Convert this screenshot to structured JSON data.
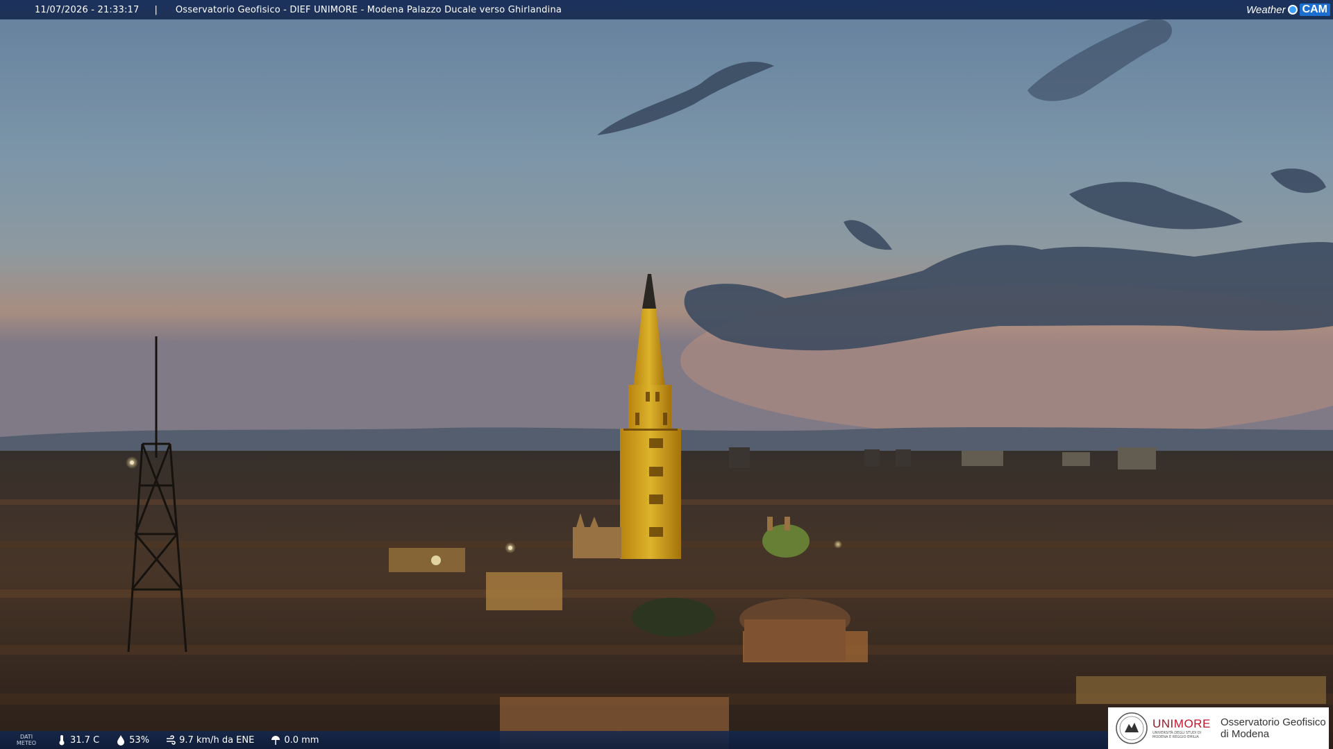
{
  "header": {
    "timestamp": "11/07/2026 - 21:33:17",
    "separator": "|",
    "title": "Osservatorio Geofisico - DIEF UNIMORE - Modena Palazzo Ducale verso Ghirlandina",
    "brand_weather": "Weather",
    "brand_cam": "CAM"
  },
  "weather": {
    "label_line1": "DATI",
    "label_line2": "METEO",
    "temperature": "31.7 C",
    "humidity": "53%",
    "wind": "9.7 km/h da ENE",
    "rain": "0.0 mm",
    "icons": [
      "thermometer-icon",
      "humidity-drop-icon",
      "wind-icon",
      "rain-gauge-icon"
    ]
  },
  "logo": {
    "uni_prefix": "UNI",
    "uni_suffix": "MORE",
    "uni_subtitle": "UNIVERSITÀ DEGLI STUDI DI MODENA E REGGIO EMILIA",
    "observatory_line1": "Osservatorio Geofisico",
    "observatory_line2": "di Modena"
  },
  "colors": {
    "sky_top": "#6f8fae",
    "sky_horizon": "#c9a088",
    "tower_lit": "#e8b423",
    "bar_blue": "#16305e"
  }
}
